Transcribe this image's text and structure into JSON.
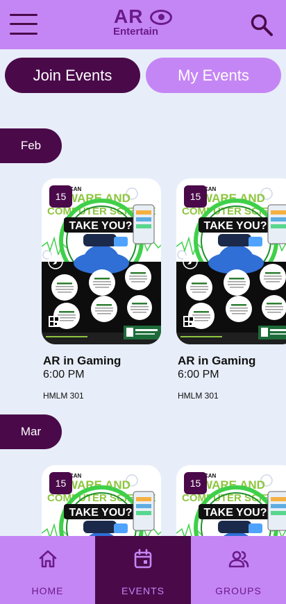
{
  "app": {
    "logo_main": "AR",
    "logo_sub": "Entertain",
    "menu_icon": "hamburger-menu-icon",
    "search_icon": "search-icon"
  },
  "tabs": {
    "join_label": "Join Events",
    "my_label": "My Events"
  },
  "months": [
    {
      "label": "Feb",
      "events": [
        {
          "day": "15",
          "title": "AR in Gaming",
          "time": "6:00 PM",
          "location": "HMLM 301"
        },
        {
          "day": "15",
          "title": "AR in Gaming",
          "time": "6:00 PM",
          "location": "HMLM 301"
        }
      ]
    },
    {
      "label": "Mar",
      "events": [
        {
          "day": "15"
        },
        {
          "day": "15"
        }
      ]
    }
  ],
  "poster": {
    "head_small": "CAN",
    "head_line": "WARE AND",
    "head_line2": "COMPUTER SCIENCE",
    "head_big": "TAKE YOU?"
  },
  "bottom_nav": [
    {
      "label": "HOME",
      "icon": "home-icon"
    },
    {
      "label": "EVENTS",
      "icon": "calendar-icon"
    },
    {
      "label": "GROUPS",
      "icon": "groups-icon"
    }
  ],
  "colors": {
    "accent": "#c586f5",
    "dark": "#4a0a4a",
    "background": "#e8eef9"
  }
}
